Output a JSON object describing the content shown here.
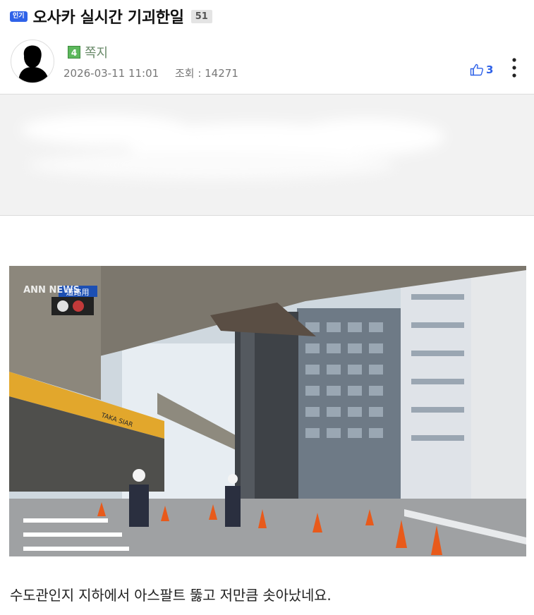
{
  "post": {
    "hot_badge": "인기",
    "title": "오사카 실시간 기괴한일",
    "comment_count": "51"
  },
  "author": {
    "level": "4",
    "name": "쪽지",
    "datetime": "2026-03-11 11:01",
    "views_label": "조회 : 14271"
  },
  "actions": {
    "like_count": "3"
  },
  "image": {
    "watermark": "ANN NEWS",
    "sign_top": "道路用",
    "sign_side": "TAKA SIAR"
  },
  "body": {
    "caption": "수도관인지 지하에서 아스팔트 뚫고 저만큼 솟아났네요."
  },
  "colors": {
    "accent_blue": "#2f62e8",
    "level_green": "#5cb85c",
    "divider": "#dcdcdc"
  }
}
